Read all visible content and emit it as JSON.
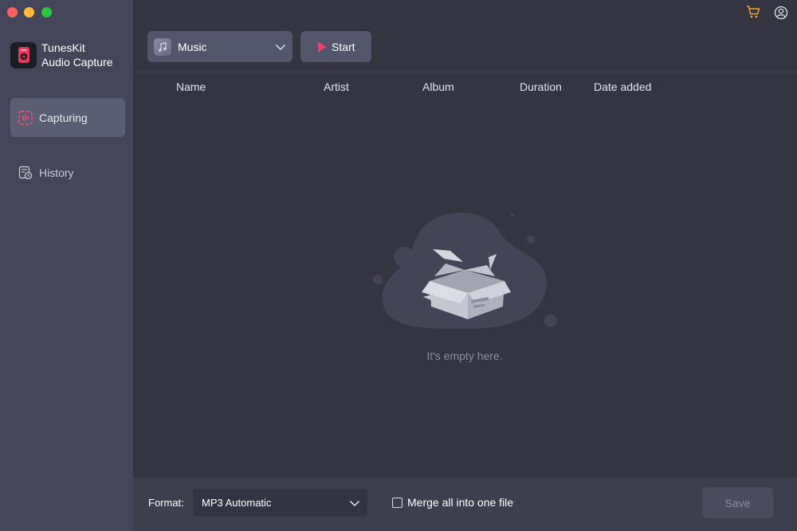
{
  "app": {
    "name_line1": "TunesKit",
    "name_line2": "Audio Capture"
  },
  "sidebar": {
    "items": [
      {
        "label": "Capturing",
        "icon": "waveform-icon",
        "active": true
      },
      {
        "label": "History",
        "icon": "history-icon",
        "active": false
      }
    ]
  },
  "header": {
    "icons": [
      "cart-icon",
      "user-account-icon"
    ],
    "accent_color": "#f5a623"
  },
  "toolbar": {
    "source_value": "Music",
    "start_label": "Start",
    "start_icon_color": "#ff3b6a"
  },
  "table": {
    "columns": [
      "Name",
      "Artist",
      "Album",
      "Duration",
      "Date added"
    ],
    "rows": []
  },
  "empty_state": {
    "message": "It's empty here."
  },
  "bottom": {
    "format_label": "Format:",
    "format_value": "MP3 Automatic",
    "merge_label": "Merge all into one file",
    "merge_checked": false,
    "save_label": "Save"
  }
}
